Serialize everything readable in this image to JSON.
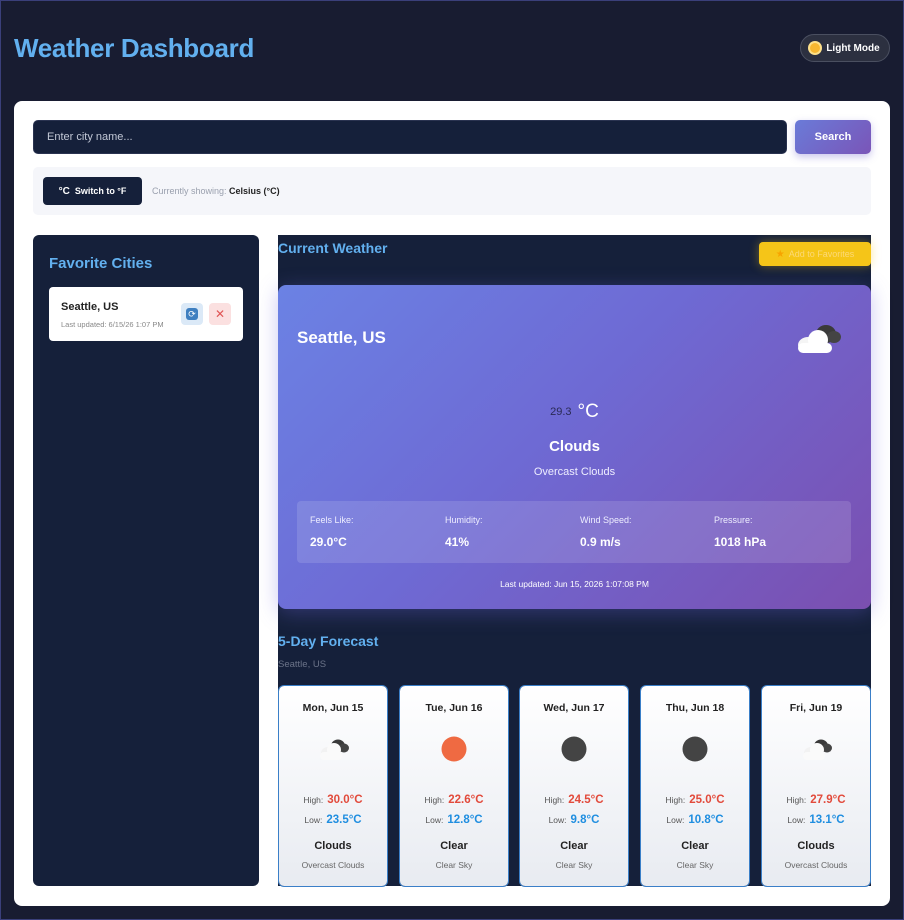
{
  "header": {
    "title": "Weather Dashboard",
    "mode_button": "Light Mode",
    "mode_icon": "sun-icon"
  },
  "search": {
    "placeholder": "Enter city name...",
    "value": "",
    "button": "Search"
  },
  "units": {
    "button_symbol": "°C",
    "button_label": "Switch to °F",
    "status_prefix": "Currently showing:",
    "status_value": "Celsius (°C)"
  },
  "favorites": {
    "title": "Favorite Cities",
    "items": [
      {
        "city": "Seattle, US",
        "updated": "Last updated: 6/15/26 1:07 PM",
        "refresh_icon": "refresh-icon",
        "remove_icon": "close-icon",
        "remove_symbol": "✕"
      }
    ]
  },
  "current": {
    "title": "Current Weather",
    "add_favorite": "Add to Favorites",
    "add_favorite_icon": "star-icon",
    "city": "Seattle, US",
    "icon": "clouds-icon",
    "temp": "29.3",
    "temp_unit": "°C",
    "main": "Clouds",
    "description": "Overcast Clouds",
    "details": [
      {
        "label": "Feels Like:",
        "value": "29.0°C"
      },
      {
        "label": "Humidity:",
        "value": "41%"
      },
      {
        "label": "Wind Speed:",
        "value": "0.9 m/s"
      },
      {
        "label": "Pressure:",
        "value": "1018 hPa"
      }
    ],
    "updated": "Last updated: Jun 15, 2026 1:07:08 PM"
  },
  "forecast": {
    "title": "5-Day Forecast",
    "subtitle": "Seattle, US",
    "high_label": "High:",
    "low_label": "Low:",
    "days": [
      {
        "date": "Mon, Jun 15",
        "icon": "clouds-icon",
        "high": "30.0°C",
        "low": "23.5°C",
        "main": "Clouds",
        "desc": "Overcast Clouds"
      },
      {
        "date": "Tue, Jun 16",
        "icon": "sun-icon",
        "high": "22.6°C",
        "low": "12.8°C",
        "main": "Clear",
        "desc": "Clear Sky"
      },
      {
        "date": "Wed, Jun 17",
        "icon": "moon-icon",
        "high": "24.5°C",
        "low": "9.8°C",
        "main": "Clear",
        "desc": "Clear Sky"
      },
      {
        "date": "Thu, Jun 18",
        "icon": "moon-icon",
        "high": "25.0°C",
        "low": "10.8°C",
        "main": "Clear",
        "desc": "Clear Sky"
      },
      {
        "date": "Fri, Jun 19",
        "icon": "clouds-icon",
        "high": "27.9°C",
        "low": "13.1°C",
        "main": "Clouds",
        "desc": "Overcast Clouds"
      }
    ]
  },
  "colors": {
    "accent": "#62b0ef",
    "panel_dark": "#15203a",
    "high_temp": "#e24a3b",
    "low_temp": "#1f8ee0",
    "favorite_button": "#f5c518"
  }
}
